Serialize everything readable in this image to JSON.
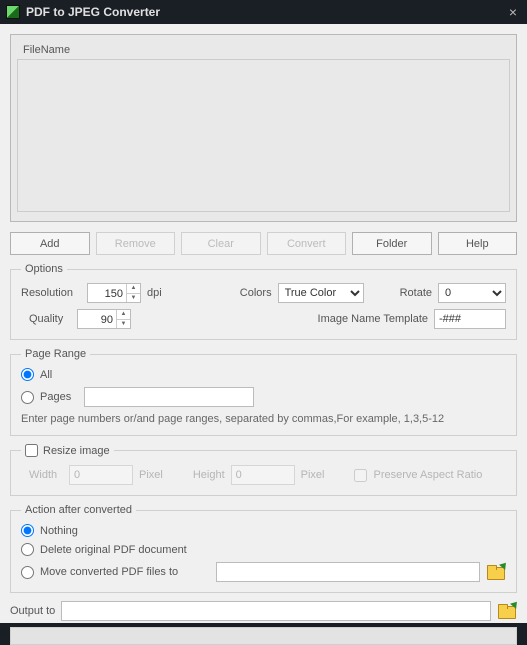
{
  "title": "PDF to JPEG Converter",
  "filelist": {
    "header": "FileName"
  },
  "buttons": {
    "add": "Add",
    "remove": "Remove",
    "clear": "Clear",
    "convert": "Convert",
    "folder": "Folder",
    "help": "Help"
  },
  "options": {
    "legend": "Options",
    "resolution_label": "Resolution",
    "resolution_value": "150",
    "resolution_unit": "dpi",
    "colors_label": "Colors",
    "colors_value": "True Color",
    "rotate_label": "Rotate",
    "rotate_value": "0",
    "quality_label": "Quality",
    "quality_value": "90",
    "template_label": "Image Name Template",
    "template_value": "-###"
  },
  "pagerange": {
    "legend": "Page Range",
    "all": "All",
    "pages": "Pages",
    "pages_value": "",
    "hint": "Enter page numbers or/and page ranges, separated by commas,For example, 1,3,5-12"
  },
  "resize": {
    "legend": "Resize image",
    "width_label": "Width",
    "width_value": "0",
    "width_unit": "Pixel",
    "height_label": "Height",
    "height_value": "0",
    "height_unit": "Pixel",
    "preserve": "Preserve Aspect Ratio"
  },
  "action": {
    "legend": "Action after converted",
    "nothing": "Nothing",
    "delete": "Delete original PDF document",
    "move": "Move converted PDF files to",
    "move_path": ""
  },
  "output": {
    "label": "Output to",
    "value": ""
  }
}
